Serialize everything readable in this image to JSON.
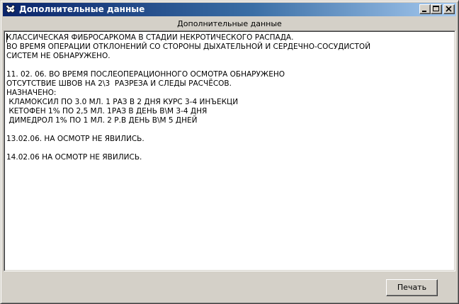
{
  "window": {
    "title": "Дополнительные данные",
    "icon": "cat-icon"
  },
  "titlebar_buttons": {
    "minimize_icon": "minimize-icon",
    "maximize_icon": "maximize-icon",
    "close_icon": "close-icon"
  },
  "panel": {
    "caption": "Дополнительные данные"
  },
  "memo": {
    "text": "КЛАССИЧЕСКАЯ ФИБРОСАРКОМА В СТАДИИ НЕКРОТИЧЕСКОГО РАСПАДА.\nВО ВРЕМЯ ОПЕРАЦИИ ОТКЛОНЕНИЙ СО СТОРОНЫ ДЫХАТЕЛЬНОЙ И СЕРДЕЧНО-СОСУДИСТОЙ\nСИСТЕМ НЕ ОБНАРУЖЕНО.\n\n11. 02. 06. ВО ВРЕМЯ ПОСЛЕОПЕРАЦИОННОГО ОСМОТРА ОБНАРУЖЕНО\nОТСУТСТВИЕ ШВОВ НА 2\\3  РАЗРЕЗА И СЛЕДЫ РАСЧЁСОВ.\nНАЗНАЧЕНО:\n КЛАМОКСИЛ ПО 3.0 МЛ. 1 РАЗ В 2 ДНЯ КУРС 3-4 ИНЪЕКЦИ\n КЕТОФЕН 1% ПО 2,5 МЛ. 1РАЗ В ДЕНЬ В\\М 3-4 ДНЯ\n ДИМЕДРОЛ 1% ПО 1 МЛ. 2 Р.В ДЕНЬ В\\М 5 ДНЕЙ\n\n13.02.06. НА ОСМОТР НЕ ЯВИЛИСЬ.\n\n14.02.06 НА ОСМОТР НЕ ЯВИЛИСЬ."
  },
  "buttons": {
    "print_label": "Печать"
  },
  "colors": {
    "title_start": "#0a246a",
    "title_end": "#a6caf0",
    "face": "#d4d0c8"
  }
}
